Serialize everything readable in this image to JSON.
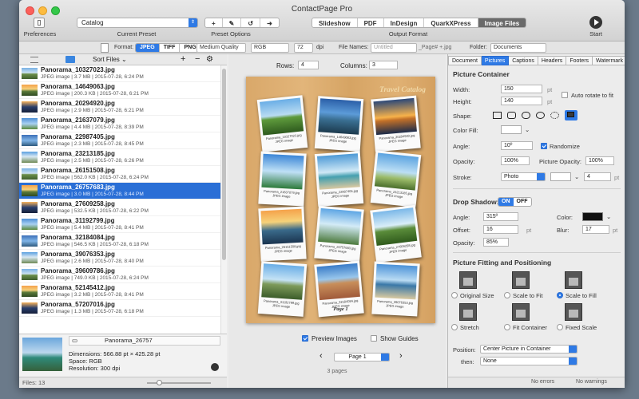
{
  "window": {
    "title": "ContactPage Pro"
  },
  "toolbar": {
    "preferences_label": "Preferences",
    "preset_value": "Catalog",
    "current_preset_label": "Current Preset",
    "preset_options_label": "Preset Options",
    "output_tabs": [
      "Slideshow",
      "PDF",
      "InDesign",
      "QuarkXPress",
      "Image Files"
    ],
    "output_active": "Image Files",
    "output_format_label": "Output Format",
    "start_label": "Start"
  },
  "format_bar": {
    "format_label": "Format:",
    "formats": [
      "JPEG",
      "TIFF",
      "PNG"
    ],
    "format_active": "JPEG",
    "quality": "Medium Quality",
    "color": "RGB",
    "dpi_value": "72",
    "dpi_label": "dpi",
    "file_names_label": "File Names:",
    "file_names_placeholder": "Untitled",
    "file_names_suffix": "_Page# +.jpg",
    "folder_label": "Folder:",
    "folder_value": "Documents"
  },
  "file_panel": {
    "sort_label": "Sort Files",
    "files": [
      {
        "name": "Panorama_10327023.jpg",
        "meta": "JPEG image | 3.7 MB | 2015-07-28, 6:24 PM"
      },
      {
        "name": "Panorama_14649063.jpg",
        "meta": "JPEG image | 200.3 KB | 2015-07-28, 6:21 PM"
      },
      {
        "name": "Panorama_20294920.jpg",
        "meta": "JPEG image | 2.9 MB | 2015-07-28, 6:21 PM"
      },
      {
        "name": "Panorama_21637079.jpg",
        "meta": "JPEG image | 4.4 MB | 2015-07-28, 8:39 PM"
      },
      {
        "name": "Panorama_22987405.jpg",
        "meta": "JPEG image | 2.3 MB | 2015-07-28, 8:45 PM"
      },
      {
        "name": "Panorama_23213185.jpg",
        "meta": "JPEG image | 2.5 MB | 2015-07-28, 6:26 PM"
      },
      {
        "name": "Panorama_26151508.jpg",
        "meta": "JPEG image | 562.0 KB | 2015-07-28, 6:24 PM"
      },
      {
        "name": "Panorama_26757683.jpg",
        "meta": "JPEG image | 3.0 MB | 2015-07-28, 8:44 PM"
      },
      {
        "name": "Panorama_27609258.jpg",
        "meta": "JPEG image | 532.5 KB | 2015-07-28, 6:22 PM"
      },
      {
        "name": "Panorama_31192799.jpg",
        "meta": "JPEG image | 5.4 MB | 2015-07-28, 8:41 PM"
      },
      {
        "name": "Panorama_32184084.jpg",
        "meta": "JPEG image | 546.5 KB | 2015-07-28, 6:18 PM"
      },
      {
        "name": "Panorama_39076353.jpg",
        "meta": "JPEG image | 2.6 MB | 2015-07-28, 8:40 PM"
      },
      {
        "name": "Panorama_39609786.jpg",
        "meta": "JPEG image | 749.0 KB | 2015-07-28, 6:24 PM"
      },
      {
        "name": "Panorama_52145412.jpg",
        "meta": "JPEG image | 3.2 MB | 2015-07-28, 8:41 PM"
      },
      {
        "name": "Panorama_57207016.jpg",
        "meta": "JPEG image | 1.3 MB | 2015-07-28, 6:18 PM"
      }
    ],
    "selected_index": 7,
    "path_name": "Panorama_26757",
    "info_dimensions": "Dimensions: 566.88 pt × 425.28 pt",
    "info_space": "Space: RGB",
    "info_resolution": "Resolution: 300 dpi",
    "files_count": "Files: 13"
  },
  "preview": {
    "rows_label": "Rows:",
    "rows_value": "4",
    "columns_label": "Columns:",
    "columns_value": "3",
    "catalog_title": "Travel Catalog",
    "page_footer": "Page 1",
    "cells": [
      {
        "caption": "Panorama_10327023.jpg",
        "sub": "JPEG image"
      },
      {
        "caption": "Panorama_14649063.jpg",
        "sub": "JPEG image"
      },
      {
        "caption": "Panorama_20294920.jpg",
        "sub": "JPEG image"
      },
      {
        "caption": "Panorama_21637079.jpg",
        "sub": "JPEG image"
      },
      {
        "caption": "Panorama_22987405.jpg",
        "sub": "JPEG image"
      },
      {
        "caption": "Panorama_23213185.jpg",
        "sub": "JPEG image"
      },
      {
        "caption": "Panorama_26151508.jpg",
        "sub": "JPEG image"
      },
      {
        "caption": "Panorama_26757683.jpg",
        "sub": "JPEG image"
      },
      {
        "caption": "Panorama_27609258.jpg",
        "sub": "JPEG image"
      },
      {
        "caption": "Panorama_31192799.jpg",
        "sub": "JPEG image"
      },
      {
        "caption": "Panorama_32184084.jpg",
        "sub": "JPEG image"
      },
      {
        "caption": "Panorama_39076353.jpg",
        "sub": "JPEG image"
      }
    ],
    "preview_images_label": "Preview Images",
    "show_guides_label": "Show Guides",
    "page_select": "Page 1",
    "pages_count": "3 pages"
  },
  "inspector": {
    "tabs": [
      "Document",
      "Pictures",
      "Captions",
      "Headers",
      "Footers",
      "Watermark"
    ],
    "active_tab": "Pictures",
    "container_title": "Picture Container",
    "width_label": "Width:",
    "width_value": "150",
    "height_label": "Height:",
    "height_value": "140",
    "unit": "pt",
    "auto_rotate_label": "Auto rotate to fit",
    "shape_label": "Shape:",
    "color_fill_label": "Color Fill:",
    "angle_label": "Angle:",
    "angle_value": "10º",
    "randomize_label": "Randomize",
    "opacity_label": "Opacity:",
    "opacity_value": "100%",
    "picture_opacity_label": "Picture Opacity:",
    "picture_opacity_value": "100%",
    "stroke_label": "Stroke:",
    "stroke_value": "Photo",
    "stroke_width": "4",
    "drop_shadow_title": "Drop Shadow:",
    "shadow_on": "ON",
    "shadow_off": "OFF",
    "shadow_angle_label": "Angle:",
    "shadow_angle_value": "315º",
    "shadow_color_label": "Color:",
    "offset_label": "Offset:",
    "offset_value": "16",
    "blur_label": "Blur:",
    "blur_value": "17",
    "shadow_opacity_label": "Opacity:",
    "shadow_opacity_value": "85%",
    "fitting_title": "Picture Fitting and Positioning",
    "fit_options": [
      "Original Size",
      "Scale to Fit",
      "Scale to Fill",
      "Stretch",
      "Fit Container",
      "Fixed Scale"
    ],
    "fit_selected": "Scale to Fill",
    "position_label": "Position:",
    "position_value": "Center Picture in Container",
    "then_label": "then:",
    "then_value": "None",
    "errors": "No errors",
    "warnings": "No warnings"
  },
  "colors": {
    "accent": "#2f7ae5",
    "selection": "#2a6fd6"
  }
}
